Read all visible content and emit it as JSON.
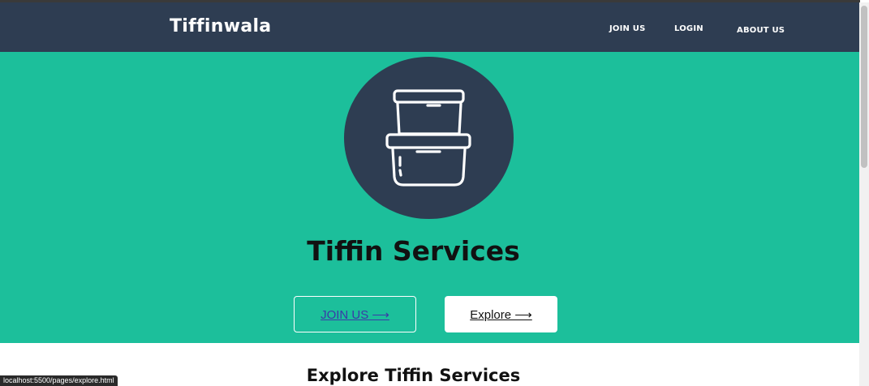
{
  "navbar": {
    "brand": "Tiffinwala",
    "links": [
      {
        "label": "JOIN US"
      },
      {
        "label": "LOGIN"
      },
      {
        "label": "ABOUT US"
      }
    ],
    "background": "#2e3d52"
  },
  "hero": {
    "title": "Tiffin Services",
    "icon": "tiffin-box-icon",
    "background": "#1cbf9b",
    "buttons": {
      "join_label": "JOIN US ⟶",
      "explore_label": "Explore ⟶"
    }
  },
  "section": {
    "title": "Explore Tiffin Services"
  },
  "status": {
    "url": "localhost:5500/pages/explore.html"
  }
}
